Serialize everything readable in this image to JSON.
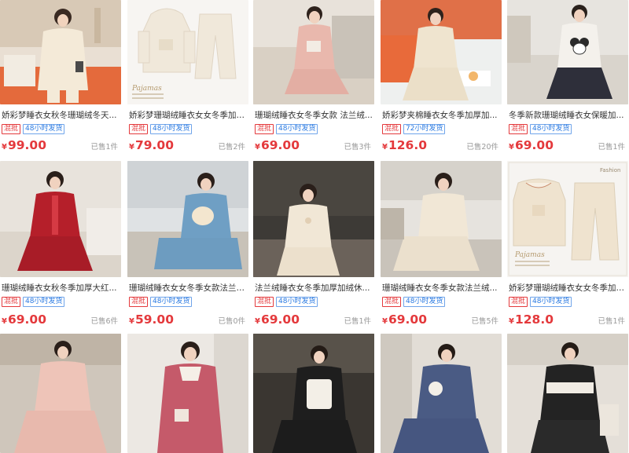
{
  "colors": {
    "price": "#e4393c",
    "tag_red": "#e4393c",
    "tag_blue": "#2a7ae2",
    "muted": "#999999"
  },
  "products": [
    {
      "title": "娇彩梦睡衣女秋冬珊瑚绒冬天...",
      "tags": [
        {
          "text": "混批",
          "style": "red"
        },
        {
          "text": "48小时发货",
          "style": "blue"
        }
      ],
      "currency": "¥",
      "price": "99.00",
      "sold": "已售1件",
      "image_icon": "beige-fleece-pajama-photo"
    },
    {
      "title": "娇彩梦珊瑚绒睡衣女女冬季加厚...",
      "tags": [
        {
          "text": "混批",
          "style": "red"
        },
        {
          "text": "48小时发货",
          "style": "blue"
        }
      ],
      "currency": "¥",
      "price": "79.00",
      "sold": "已售2件",
      "image_icon": "flat-lay-pajama-set-photo",
      "caption": "Pajamas"
    },
    {
      "title": "珊瑚绒睡衣女冬季女款 法兰绒...",
      "tags": [
        {
          "text": "混批",
          "style": "red"
        },
        {
          "text": "48小时发货",
          "style": "blue"
        }
      ],
      "currency": "¥",
      "price": "69.00",
      "sold": "已售3件",
      "image_icon": "pink-pajama-photo"
    },
    {
      "title": "娇彩梦夹棉睡衣女冬季加厚加...",
      "tags": [
        {
          "text": "混批",
          "style": "red"
        },
        {
          "text": "72小时发货",
          "style": "blue"
        }
      ],
      "currency": "¥",
      "price": "126.0",
      "sold": "已售20件",
      "image_icon": "quilted-beige-pajama-photo"
    },
    {
      "title": "冬季新款珊瑚绒睡衣女保暖加...",
      "tags": [
        {
          "text": "混批",
          "style": "red"
        },
        {
          "text": "48小时发货",
          "style": "blue"
        }
      ],
      "currency": "¥",
      "price": "69.00",
      "sold": "已售1件",
      "image_icon": "panda-print-pajama-photo"
    },
    {
      "title": "珊瑚绒睡衣女秋冬季加厚大红...",
      "tags": [
        {
          "text": "混批",
          "style": "red"
        },
        {
          "text": "48小时发货",
          "style": "blue"
        }
      ],
      "currency": "¥",
      "price": "69.00",
      "sold": "已售6件",
      "image_icon": "red-fleece-pajama-photo"
    },
    {
      "title": "珊瑚绒睡衣女女冬季女款法兰绒...",
      "tags": [
        {
          "text": "混批",
          "style": "red"
        },
        {
          "text": "48小时发货",
          "style": "blue"
        }
      ],
      "currency": "¥",
      "price": "59.00",
      "sold": "已售0件",
      "image_icon": "blue-dog-print-pajama-photo"
    },
    {
      "title": "法兰绒睡衣女冬季加厚加绒休...",
      "tags": [
        {
          "text": "混批",
          "style": "red"
        },
        {
          "text": "48小时发货",
          "style": "blue"
        }
      ],
      "currency": "¥",
      "price": "69.00",
      "sold": "已售1件",
      "image_icon": "cream-ruffle-pajama-photo"
    },
    {
      "title": "珊瑚绒睡衣女冬季女款法兰绒...",
      "tags": [
        {
          "text": "混批",
          "style": "red"
        },
        {
          "text": "48小时发货",
          "style": "blue"
        }
      ],
      "currency": "¥",
      "price": "69.00",
      "sold": "已售5件",
      "image_icon": "quilted-cream-pajama-photo"
    },
    {
      "title": "娇彩梦珊瑚绒睡衣女女冬季加厚...",
      "tags": [
        {
          "text": "混批",
          "style": "red"
        },
        {
          "text": "48小时发货",
          "style": "blue"
        }
      ],
      "currency": "¥",
      "price": "128.0",
      "sold": "已售1件",
      "image_icon": "collar-pajama-flat-lay-photo",
      "caption": "Pajamas",
      "brand": "Fashion"
    },
    {
      "title": "",
      "image_icon": "pink-quilted-pajama-photo"
    },
    {
      "title": "",
      "image_icon": "rose-pajama-with-cardigan-photo"
    },
    {
      "title": "",
      "image_icon": "black-bear-print-pajama-photo"
    },
    {
      "title": "",
      "image_icon": "navy-bear-print-pajama-photo"
    },
    {
      "title": "",
      "image_icon": "black-white-trim-pajama-photo"
    }
  ]
}
